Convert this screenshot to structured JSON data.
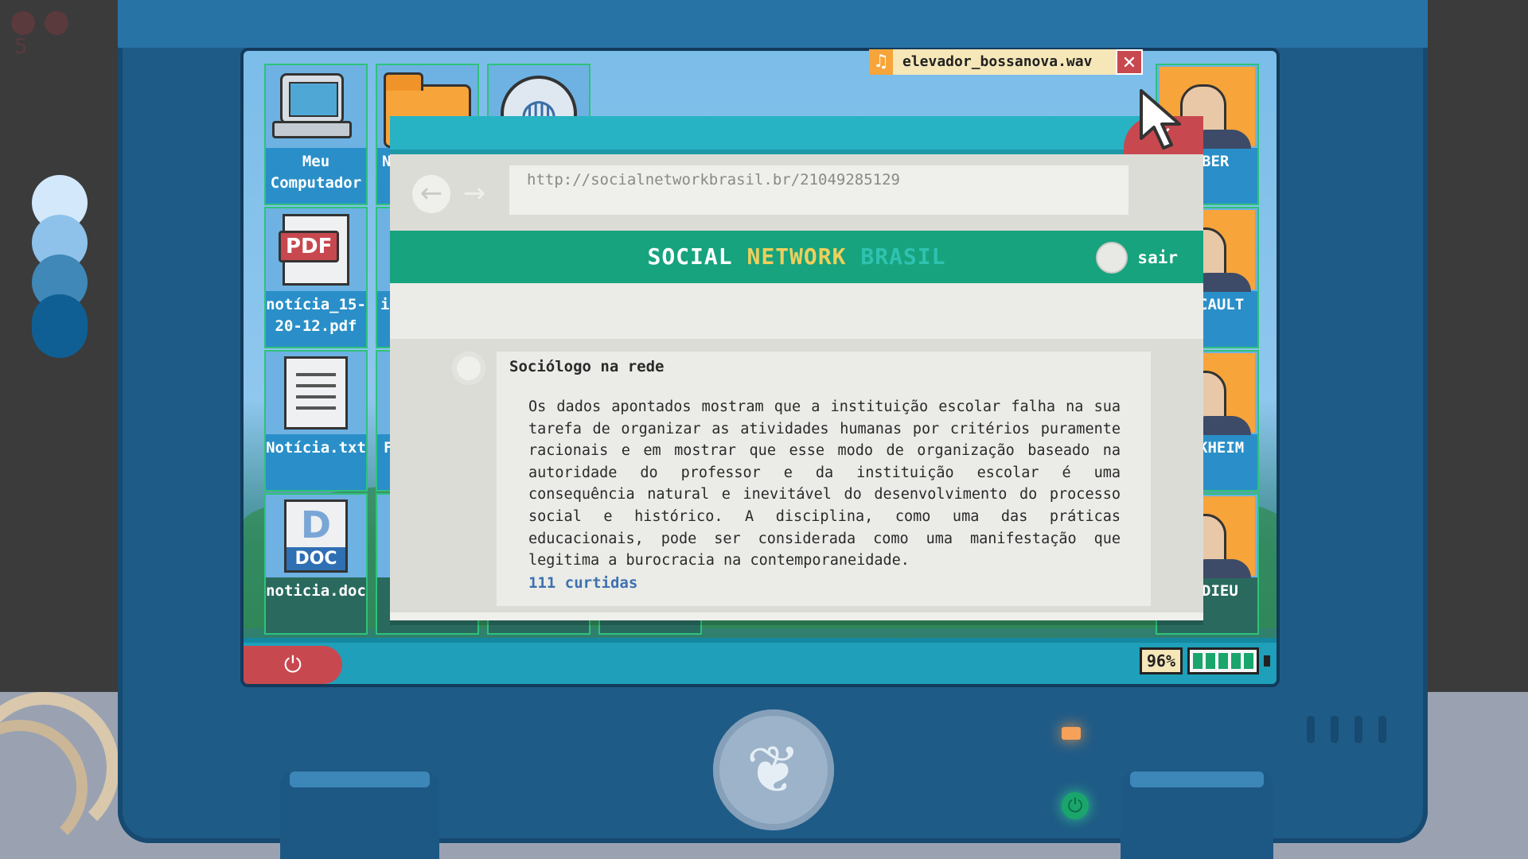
{
  "desktop": {
    "icons": [
      {
        "label": "Meu Computador",
        "glyph": "computer-icon"
      },
      {
        "label": "N",
        "glyph": "folder-icon"
      },
      {
        "label": "",
        "glyph": "globe-icon"
      },
      {
        "label": "notícia_15-20-12.pdf",
        "glyph": "pdf-icon"
      },
      {
        "label": "in",
        "glyph": "file-icon"
      },
      {
        "label": "Notícia.txt",
        "glyph": "text-file-icon"
      },
      {
        "label": "F",
        "glyph": "file-icon"
      },
      {
        "label": "noticia.doc",
        "glyph": "doc-icon"
      },
      {
        "label": "BER",
        "glyph": "portrait-icon"
      },
      {
        "label": "CAULT",
        "glyph": "portrait-icon"
      },
      {
        "label": "KHEIM",
        "glyph": "portrait-icon"
      },
      {
        "label": "DIEU",
        "glyph": "portrait-icon"
      }
    ],
    "pdf_badge": "PDF",
    "doc_letter": "D",
    "doc_badge": "DOC"
  },
  "music_player": {
    "filename": "elevador_bossanova.wav",
    "note_glyph": "♫",
    "close_glyph": "✕"
  },
  "browser": {
    "close_glyph": "✕",
    "back_glyph": "←",
    "forward_glyph": "→",
    "url": "http://socialnetworkbrasil.br/21049285129",
    "site": {
      "title_words": [
        "SOCIAL",
        "NETWORK",
        "BRASIL"
      ],
      "logout_label": "sair"
    },
    "post": {
      "author": "Sociólogo na rede",
      "body": "Os dados apontados mostram que a instituição escolar falha na sua tarefa de organizar as atividades humanas por critérios puramente racionais e em mostrar que esse modo de organização baseado na autoridade do professor e da instituição escolar é uma consequência natural e inevitável do desenvolvimento do processo social e histórico. A disciplina, como uma das práticas educacionais, pode ser considerada como uma manifestação que legitima a burocracia na contemporaneidade.",
      "likes": "111 curtidas"
    }
  },
  "taskbar": {
    "power_glyph": "⏻",
    "battery_percent": "96%",
    "battery_level": 0.96
  },
  "hardware": {
    "logo_glyph": "❦",
    "power_led_glyph": "⏻"
  },
  "room": {
    "note_text": "5"
  },
  "colors": {
    "accent_green": "#16a37e",
    "accent_yellow": "#f0cf5a",
    "accent_teal": "#2fc2b0",
    "close_red": "#c8484f",
    "folder_orange": "#f7a43a"
  }
}
